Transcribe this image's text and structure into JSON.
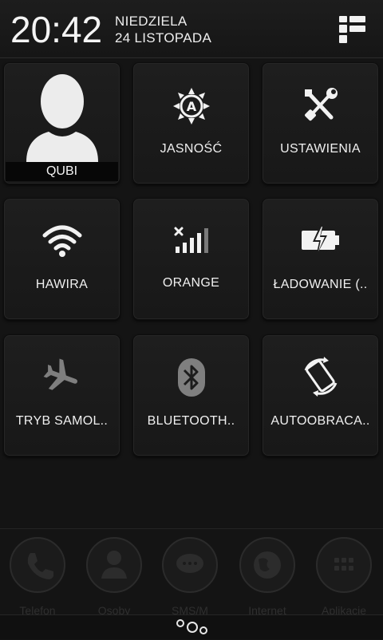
{
  "status": {
    "time": "20:42",
    "day": "NIEDZIELA",
    "date": "24 LISTOPADA"
  },
  "tiles": [
    {
      "label": "QUBI",
      "icon": "user-avatar-icon"
    },
    {
      "label": "JASNOŚĆ",
      "icon": "auto-brightness-icon"
    },
    {
      "label": "USTAWIENIA",
      "icon": "tools-icon"
    },
    {
      "label": "HAWIRA",
      "icon": "wifi-icon"
    },
    {
      "label": "ORANGE",
      "icon": "signal-icon"
    },
    {
      "label": "ŁADOWANIE (..",
      "icon": "battery-charging-icon"
    },
    {
      "label": "TRYB SAMOL..",
      "icon": "airplane-icon"
    },
    {
      "label": "BLUETOOTH..",
      "icon": "bluetooth-icon"
    },
    {
      "label": "AUTOOBRACA..",
      "icon": "auto-rotate-icon"
    }
  ],
  "dock": [
    {
      "label": "Telefon",
      "icon": "phone-icon"
    },
    {
      "label": "Osoby",
      "icon": "person-icon"
    },
    {
      "label": "SMS/M",
      "icon": "message-icon"
    },
    {
      "label": "Internet",
      "icon": "globe-icon"
    },
    {
      "label": "Aplikacje",
      "icon": "apps-icon"
    }
  ],
  "colors": {
    "background": "#141414",
    "tile": "#1c1c1c",
    "text": "#f0f0f0",
    "icon": "#f2f2f2",
    "icon_disabled": "#8a8a8a"
  }
}
